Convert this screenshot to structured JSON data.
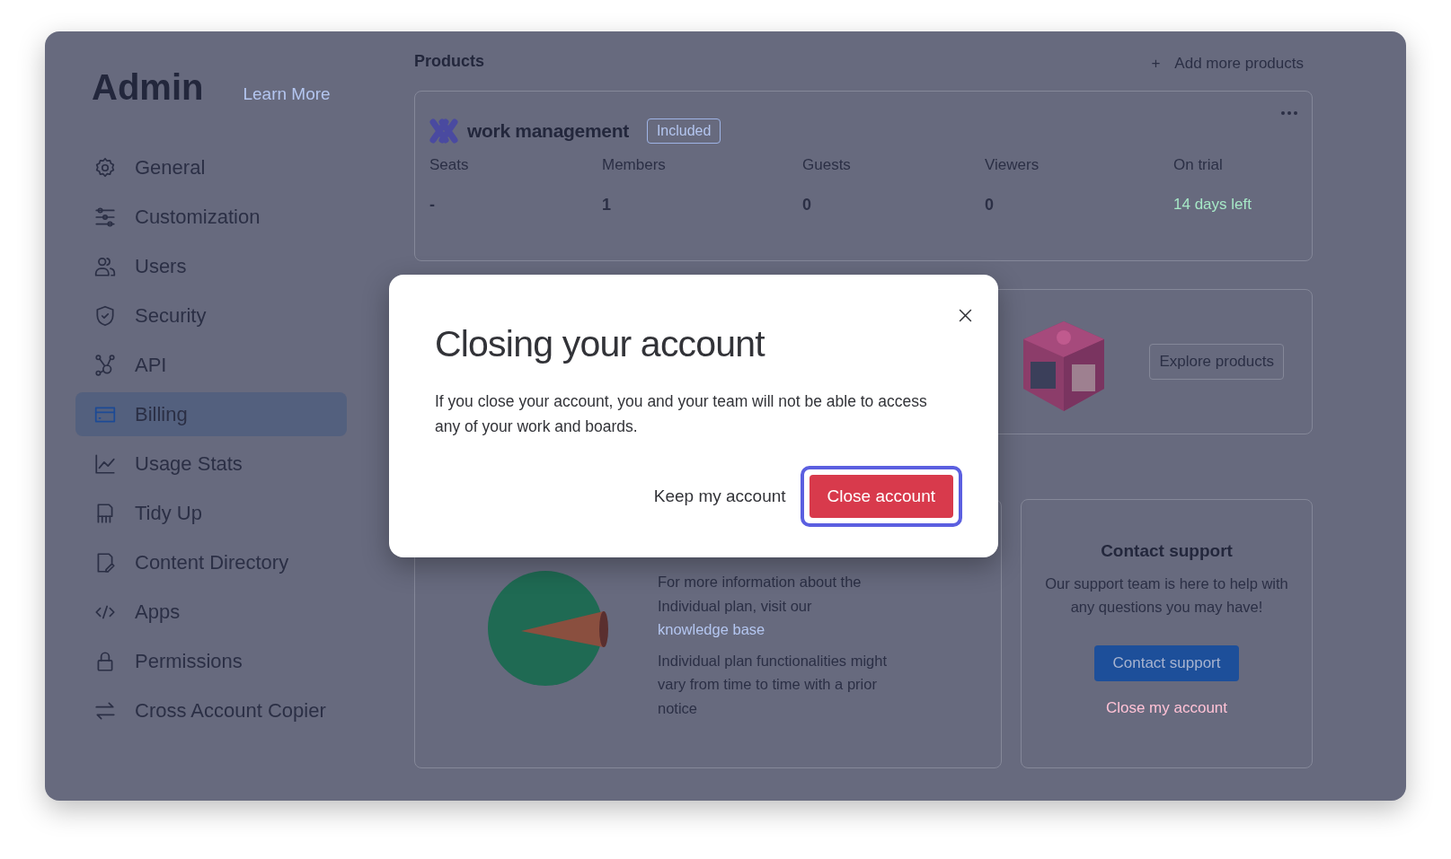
{
  "sidebar": {
    "title": "Admin",
    "learn_more": "Learn More",
    "items": [
      {
        "label": "General",
        "selected": false
      },
      {
        "label": "Customization",
        "selected": false
      },
      {
        "label": "Users",
        "selected": false
      },
      {
        "label": "Security",
        "selected": false
      },
      {
        "label": "API",
        "selected": false
      },
      {
        "label": "Billing",
        "selected": true
      },
      {
        "label": "Usage Stats",
        "selected": false
      },
      {
        "label": "Tidy Up",
        "selected": false
      },
      {
        "label": "Content Directory",
        "selected": false
      },
      {
        "label": "Apps",
        "selected": false
      },
      {
        "label": "Permissions",
        "selected": false
      },
      {
        "label": "Cross Account Copier",
        "selected": false
      }
    ]
  },
  "products": {
    "heading": "Products",
    "add_more": "Add more products",
    "add_icon": "+",
    "product": {
      "name": "work management",
      "badge": "Included",
      "stats": [
        {
          "label": "Seats",
          "value": "-",
          "kind": "plain"
        },
        {
          "label": "Members",
          "value": "1",
          "kind": "plain"
        },
        {
          "label": "Guests",
          "value": "0",
          "kind": "plain"
        },
        {
          "label": "Viewers",
          "value": "0",
          "kind": "plain"
        },
        {
          "label": "On trial",
          "value": "14 days left",
          "kind": "highlight"
        }
      ]
    },
    "explore_button": "Explore products"
  },
  "info": {
    "text_before": "For more information about the Individual plan, visit our",
    "link": "knowledge base",
    "note": "Individual plan functionalities might vary from time to time with a prior notice"
  },
  "support": {
    "title": "Contact support",
    "text": "Our support team is here to help with any questions you may have!",
    "button": "Contact support",
    "close_link": "Close my account"
  },
  "modal": {
    "title": "Closing your account",
    "body": "If you close your account, you and your team will not be able to access any of your work and boards.",
    "keep_button": "Keep my account",
    "close_button": "Close account",
    "close_focused": true
  }
}
